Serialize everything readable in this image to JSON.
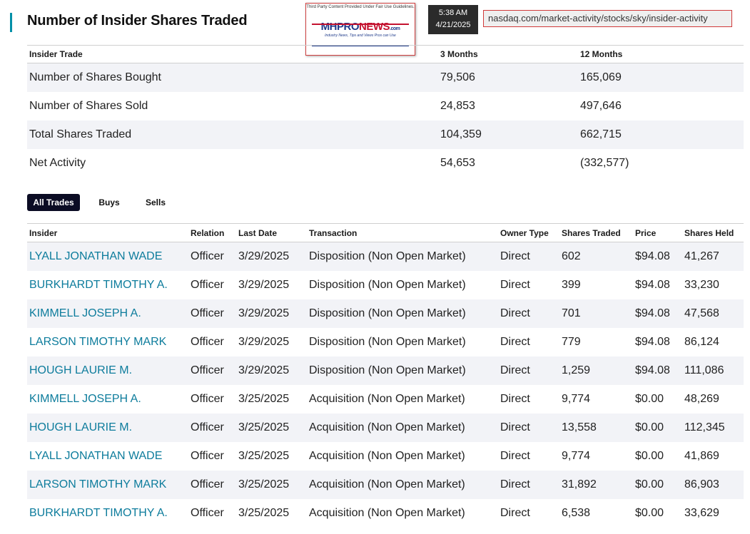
{
  "page": {
    "title": "Number of Insider Shares Traded",
    "accent_color": "#0090a8"
  },
  "overlay": {
    "logo": {
      "caption": "Third Party Content Provided Under Fair Use Guidelines.",
      "mh": "MH",
      "pro": "PRO",
      "news": "NEWS",
      "dotcom": ".com",
      "tagline": "Industry News, Tips and Views Pros can Use"
    },
    "clock": {
      "time": "5:38 AM",
      "date": "4/21/2025"
    },
    "url": "nasdaq.com/market-activity/stocks/sky/insider-activity"
  },
  "summary": {
    "headers": [
      "Insider Trade",
      "3 Months",
      "12 Months"
    ],
    "rows": [
      [
        "Number of Shares Bought",
        "79,506",
        "165,069"
      ],
      [
        "Number of Shares Sold",
        "24,853",
        "497,646"
      ],
      [
        "Total Shares Traded",
        "104,359",
        "662,715"
      ],
      [
        "Net Activity",
        "54,653",
        "(332,577)"
      ]
    ]
  },
  "tabs": [
    "All Trades",
    "Buys",
    "Sells"
  ],
  "active_tab_color": "#0b0c24",
  "link_color": "#0d7c9c",
  "trades": {
    "headers": [
      "Insider",
      "Relation",
      "Last Date",
      "Transaction",
      "Owner Type",
      "Shares Traded",
      "Price",
      "Shares Held"
    ],
    "rows": [
      [
        "LYALL JONATHAN WADE",
        "Officer",
        "3/29/2025",
        "Disposition (Non Open Market)",
        "Direct",
        "602",
        "$94.08",
        "41,267"
      ],
      [
        "BURKHARDT TIMOTHY A.",
        "Officer",
        "3/29/2025",
        "Disposition (Non Open Market)",
        "Direct",
        "399",
        "$94.08",
        "33,230"
      ],
      [
        "KIMMELL JOSEPH A.",
        "Officer",
        "3/29/2025",
        "Disposition (Non Open Market)",
        "Direct",
        "701",
        "$94.08",
        "47,568"
      ],
      [
        "LARSON TIMOTHY MARK",
        "Officer",
        "3/29/2025",
        "Disposition (Non Open Market)",
        "Direct",
        "779",
        "$94.08",
        "86,124"
      ],
      [
        "HOUGH LAURIE M.",
        "Officer",
        "3/29/2025",
        "Disposition (Non Open Market)",
        "Direct",
        "1,259",
        "$94.08",
        "111,086"
      ],
      [
        "KIMMELL JOSEPH A.",
        "Officer",
        "3/25/2025",
        "Acquisition (Non Open Market)",
        "Direct",
        "9,774",
        "$0.00",
        "48,269"
      ],
      [
        "HOUGH LAURIE M.",
        "Officer",
        "3/25/2025",
        "Acquisition (Non Open Market)",
        "Direct",
        "13,558",
        "$0.00",
        "112,345"
      ],
      [
        "LYALL JONATHAN WADE",
        "Officer",
        "3/25/2025",
        "Acquisition (Non Open Market)",
        "Direct",
        "9,774",
        "$0.00",
        "41,869"
      ],
      [
        "LARSON TIMOTHY MARK",
        "Officer",
        "3/25/2025",
        "Acquisition (Non Open Market)",
        "Direct",
        "31,892",
        "$0.00",
        "86,903"
      ],
      [
        "BURKHARDT TIMOTHY A.",
        "Officer",
        "3/25/2025",
        "Acquisition (Non Open Market)",
        "Direct",
        "6,538",
        "$0.00",
        "33,629"
      ]
    ]
  }
}
